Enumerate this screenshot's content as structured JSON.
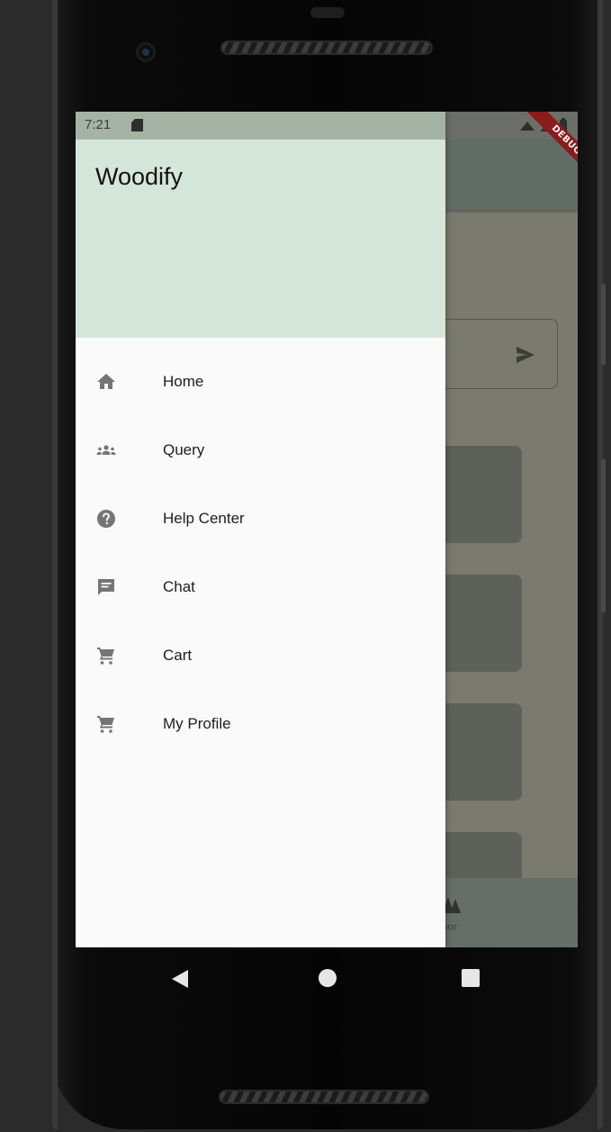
{
  "status_bar": {
    "time": "7:21"
  },
  "debug_banner": {
    "label": "DEBUG"
  },
  "drawer": {
    "title": "Woodify",
    "header_color": "#d5e6da",
    "items": [
      {
        "label": "Home",
        "icon": "home-icon"
      },
      {
        "label": "Query",
        "icon": "groups-icon"
      },
      {
        "label": "Help Center",
        "icon": "help-icon"
      },
      {
        "label": "Chat",
        "icon": "chat-icon"
      },
      {
        "label": "Cart",
        "icon": "cart-icon"
      },
      {
        "label": "My Profile",
        "icon": "cart-icon"
      }
    ]
  },
  "background_app": {
    "send_icon": "send-icon",
    "card_plus": "+",
    "nav_partial_label": "door"
  },
  "system_nav": {
    "back": "back-icon",
    "home": "home-circle-icon",
    "recents": "recents-icon"
  },
  "colors": {
    "icon_gray": "#757575",
    "scrim": "#7a7a6e",
    "ribbon": "#8a1c1c"
  }
}
